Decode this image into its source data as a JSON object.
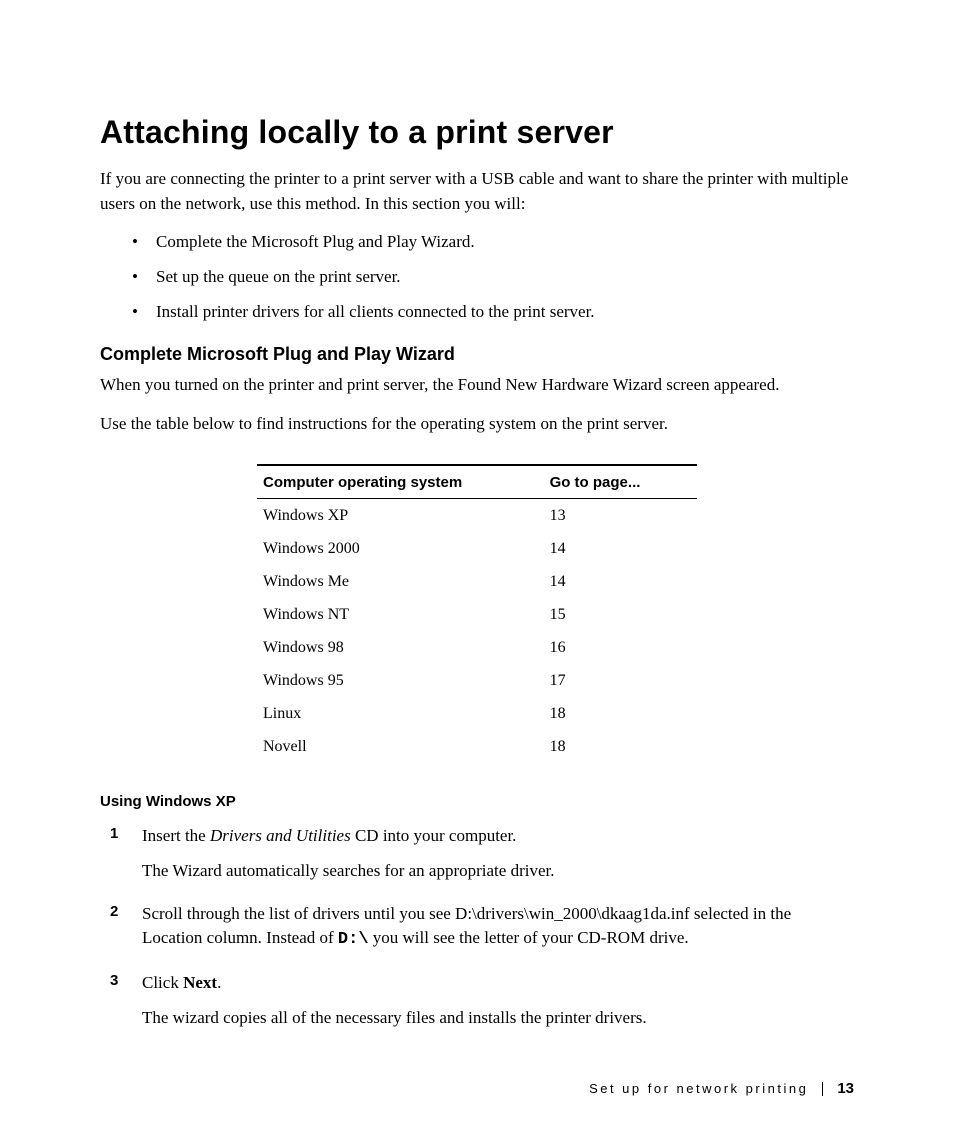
{
  "heading": "Attaching locally to a print server",
  "intro": "If you are connecting the printer to a print server with a USB cable and want to share the printer with multiple users on the network, use this method. In this section you will:",
  "bullets": [
    "Complete the Microsoft Plug and Play Wizard.",
    "Set up the queue on the print server.",
    "Install printer drivers for all clients connected to the print server."
  ],
  "sub_heading": "Complete Microsoft Plug and Play Wizard",
  "sub_para1": "When you turned on the printer and print server, the Found New Hardware Wizard screen appeared.",
  "sub_para2": "Use the table below to find instructions for the operating system on the print server.",
  "table": {
    "header_os": "Computer operating system",
    "header_page": "Go to page...",
    "rows": [
      {
        "os": "Windows XP",
        "page": "13"
      },
      {
        "os": "Windows 2000",
        "page": "14"
      },
      {
        "os": "Windows Me",
        "page": "14"
      },
      {
        "os": "Windows NT",
        "page": "15"
      },
      {
        "os": "Windows 98",
        "page": "16"
      },
      {
        "os": "Windows 95",
        "page": "17"
      },
      {
        "os": "Linux",
        "page": "18"
      },
      {
        "os": "Novell",
        "page": "18"
      }
    ]
  },
  "sub_sub_heading": "Using Windows XP",
  "step1": {
    "a": "Insert the ",
    "italic": "Drivers and Utilities",
    "b": " CD into your computer.",
    "follow": "The Wizard automatically searches for an appropriate driver."
  },
  "step2": {
    "a": "Scroll through the list of drivers until you see D:\\drivers\\win_2000\\dkaag1da.inf selected in the Location column. Instead of ",
    "mono": "D:\\",
    "b": " you will see the letter of your CD-ROM drive."
  },
  "step3": {
    "a": "Click ",
    "bold": "Next",
    "b": ".",
    "follow": "The wizard copies all of the necessary files and installs the printer drivers."
  },
  "footer": {
    "section": "Set up for network printing",
    "page_num": "13"
  }
}
